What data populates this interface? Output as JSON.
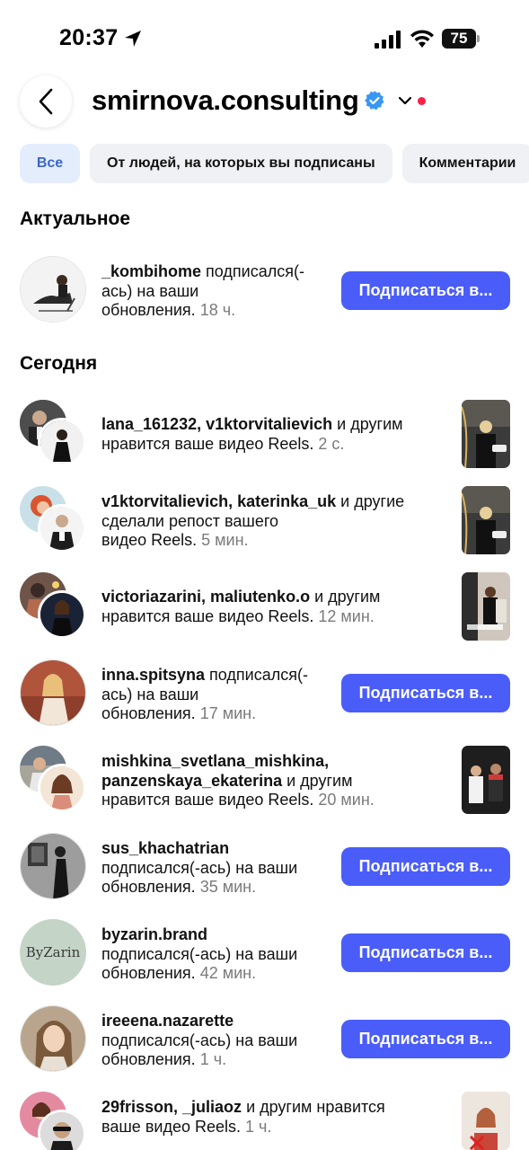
{
  "status_bar": {
    "time": "20:37",
    "battery": "75"
  },
  "header": {
    "title": "smirnova.consulting"
  },
  "filters": [
    "Все",
    "От людей, на которых вы подписаны",
    "Комментарии"
  ],
  "sections": {
    "relevant": "Актуальное",
    "today": "Сегодня"
  },
  "follow_label": "Подписаться в...",
  "notifications": [
    {
      "line1": "_kombihome",
      "line1b": " подписался(-",
      "line2": "ась) на ваши",
      "line3": "обновления.",
      "time": " 18 ч."
    },
    {
      "users": "lana_161232, v1ktorvitalievich",
      "rest": " и другим",
      "line2": "нравится ваше видео Reels.",
      "time": " 2 с."
    },
    {
      "users": "v1ktorvitalievich, katerinka_uk",
      "rest": " и другие",
      "line2": "сделали репост вашего",
      "line3": "видео Reels.",
      "time": " 5 мин."
    },
    {
      "users": "victoriazarini, maliutenko.o",
      "rest": " и другим",
      "line2": "нравится ваше видео Reels.",
      "time": " 12 мин."
    },
    {
      "line1": "inna.spitsyna",
      "line1b": " подписался(-",
      "line2": "ась) на ваши",
      "line3": "обновления.",
      "time": " 17 мин."
    },
    {
      "users": "mishkina_svetlana_mishkina,",
      "users2": "panzenskaya_ekaterina",
      "rest": " и другим",
      "line3": "нравится ваше видео Reels.",
      "time": " 20 мин."
    },
    {
      "user": "sus_khachatrian",
      "line2": "подписался(-ась) на ваши",
      "line3": "обновления.",
      "time": " 35 мин."
    },
    {
      "user": "byzarin.brand",
      "avatar_text": "ByZarin",
      "line2": "подписался(-ась) на ваши",
      "line3": "обновления.",
      "time": " 42 мин."
    },
    {
      "user": "ireeena.nazarette",
      "line2": "подписался(-ась) на ваши",
      "line3": "обновления.",
      "time": " 1 ч."
    },
    {
      "users": "29frisson, _juliaoz",
      "rest": " и другим нравится",
      "line2": "ваше видео Reels.",
      "time": " 1 ч."
    }
  ],
  "colors": {
    "accent": "#4a5df9",
    "chip_active_bg": "#e4edfc",
    "chip_active_text": "#3d67c9",
    "meta": "#7a7a7a",
    "verified": "#3897f0",
    "dot": "#ff1f47"
  }
}
